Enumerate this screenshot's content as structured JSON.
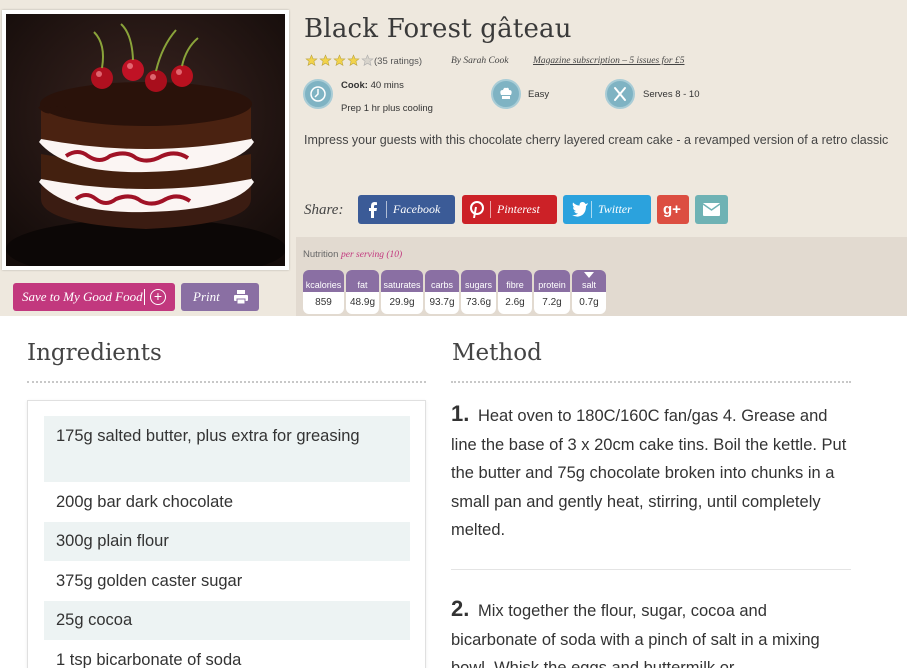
{
  "recipe": {
    "title": "Black Forest gâteau",
    "ratings": "(35 ratings)",
    "author": "By Sarah Cook",
    "promo": "Magazine subscription – 5 issues for £5",
    "rating_stars": 4,
    "cook_label": "Cook:",
    "cook_value": "40 mins",
    "prep": "Prep 1 hr plus cooling",
    "skill": "Easy",
    "serves": "Serves 8 - 10",
    "intro": "Impress your guests with this chocolate cherry layered cream cake - a revamped version of a retro classic"
  },
  "actions": {
    "save_label": "Save to My Good Food",
    "print_label": "Print"
  },
  "share": {
    "label": "Share:",
    "facebook": "Facebook",
    "pinterest": "Pinterest",
    "twitter": "Twitter",
    "googleplus": "g+"
  },
  "nutrition": {
    "label": "Nutrition",
    "per": "per serving (10)",
    "items": [
      {
        "name": "kcalories",
        "value": "859"
      },
      {
        "name": "fat",
        "value": "48.9g"
      },
      {
        "name": "saturates",
        "value": "29.9g"
      },
      {
        "name": "carbs",
        "value": "93.7g"
      },
      {
        "name": "sugars",
        "value": "73.6g"
      },
      {
        "name": "fibre",
        "value": "2.6g"
      },
      {
        "name": "protein",
        "value": "7.2g"
      },
      {
        "name": "salt",
        "value": "0.7g"
      }
    ]
  },
  "ingredients": {
    "heading": "Ingredients",
    "items": [
      "175g salted butter, plus extra for greasing",
      "200g bar dark chocolate",
      "300g plain flour",
      "375g golden caster sugar",
      "25g cocoa",
      "1 tsp bicarbonate of soda"
    ]
  },
  "method": {
    "heading": "Method",
    "steps": [
      {
        "num": "1.",
        "text": "Heat oven to 180C/160C fan/gas 4. Grease and line the base of 3 x 20cm cake tins. Boil the kettle. Put the butter and 75g chocolate broken into chunks in a small pan and gently heat, stirring, until completely melted."
      },
      {
        "num": "2.",
        "text": "Mix together the flour, sugar, cocoa and bicarbonate of soda with a pinch of salt in a mixing bowl. Whisk the eggs and buttermilk or"
      }
    ]
  },
  "colors": {
    "band": "#eee8de",
    "save": "#c2387e",
    "print": "#8a6fa3",
    "facebook": "#3b5b97",
    "pinterest": "#cc2127",
    "twitter": "#2ba2dd",
    "googleplus": "#dc4e41",
    "email": "#6fb2b4",
    "meta_icon": "#7fb3c3",
    "ingredient_stripe": "#edf3f3"
  }
}
